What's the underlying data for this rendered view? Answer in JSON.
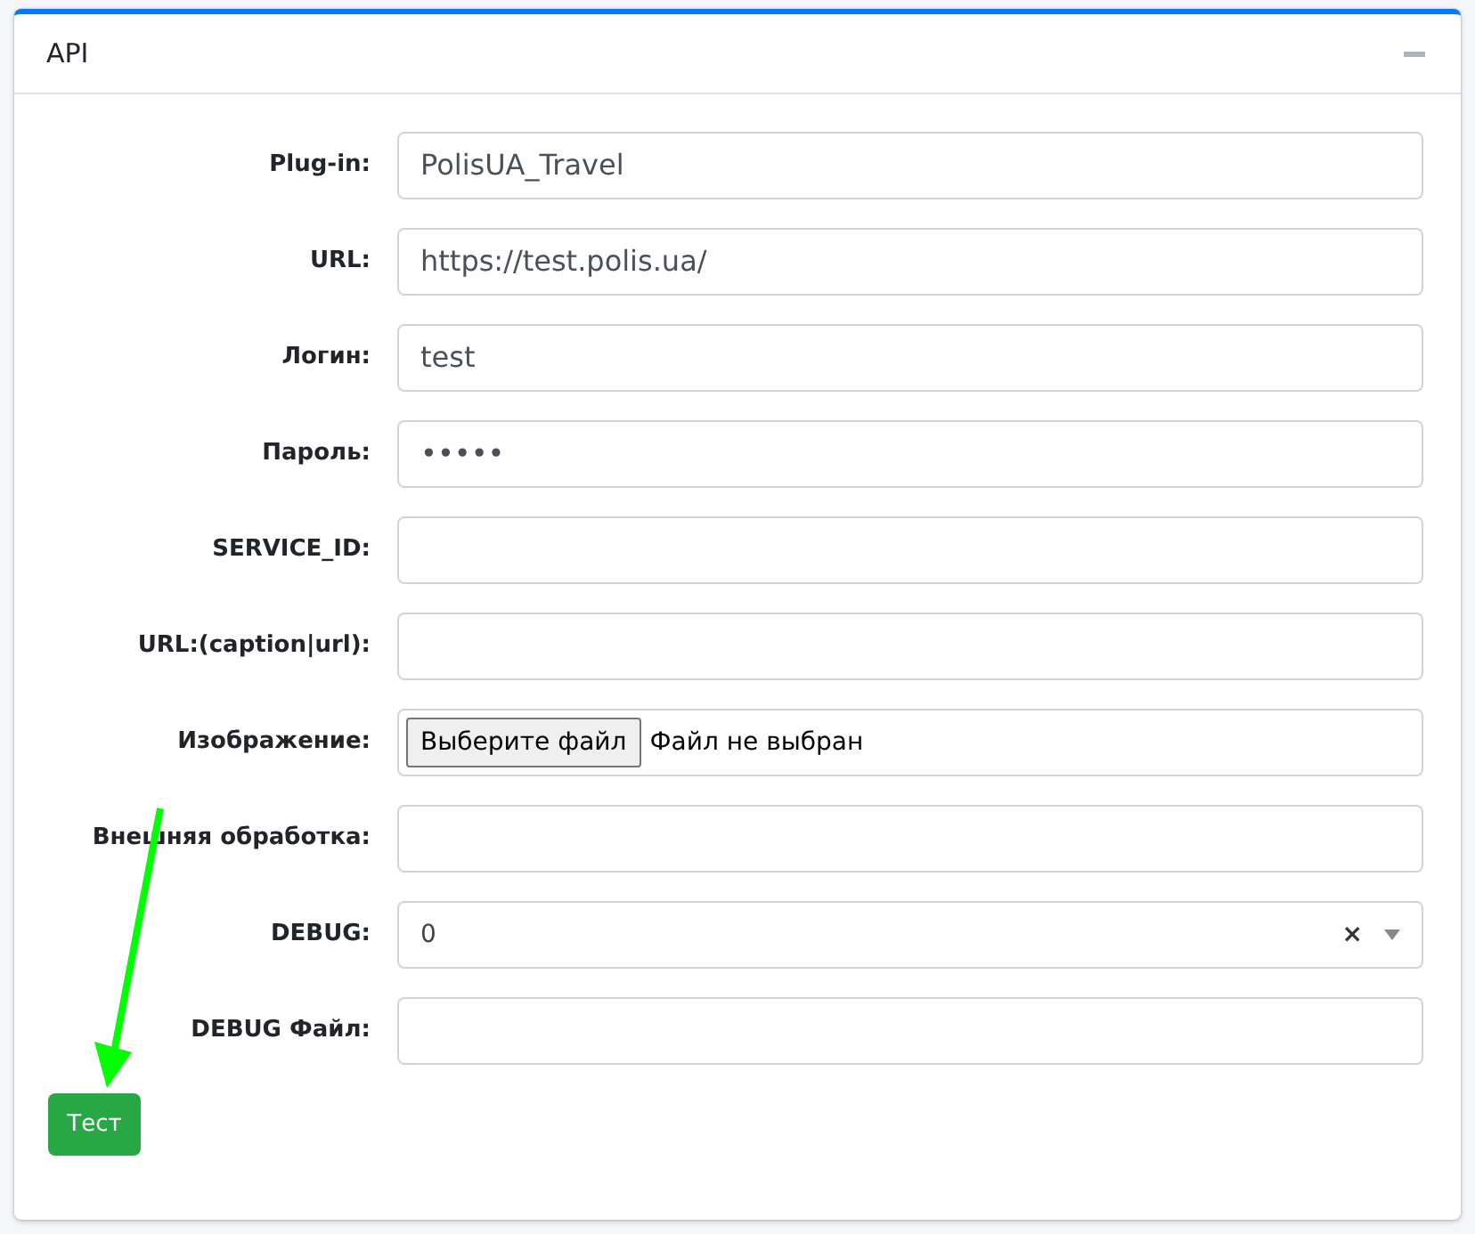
{
  "card": {
    "title": "API"
  },
  "fields": [
    {
      "kind": "text",
      "label": "Plug-in:",
      "value": "PolisUA_Travel"
    },
    {
      "kind": "text",
      "label": "URL:",
      "value": "https://test.polis.ua/"
    },
    {
      "kind": "text",
      "label": "Логин:",
      "value": "test"
    },
    {
      "kind": "text",
      "label": "Пароль:",
      "value": "•••••"
    },
    {
      "kind": "text",
      "label": "SERVICE_ID:"
    },
    {
      "kind": "text",
      "label": "URL:(caption|url):"
    },
    {
      "kind": "file",
      "label": "Изображение:",
      "button": "Выберите файл",
      "status": "Файл не выбран"
    },
    {
      "kind": "text",
      "label": "Внешняя обработка:"
    },
    {
      "kind": "select",
      "label": "DEBUG:",
      "value": "0",
      "clear": "×"
    },
    {
      "kind": "text",
      "label": "DEBUG Файл:"
    }
  ],
  "button": "Тест"
}
